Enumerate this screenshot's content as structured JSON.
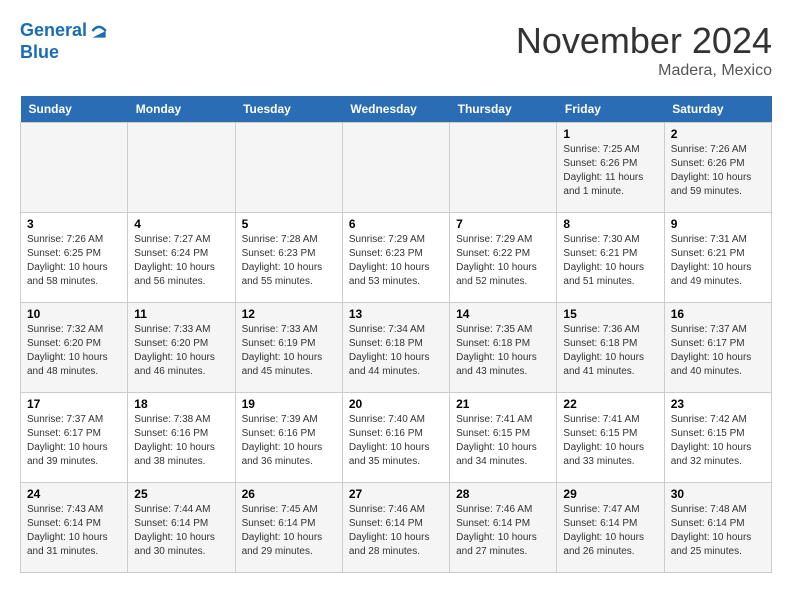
{
  "logo": {
    "line1": "General",
    "line2": "Blue"
  },
  "title": "November 2024",
  "location": "Madera, Mexico",
  "days_of_week": [
    "Sunday",
    "Monday",
    "Tuesday",
    "Wednesday",
    "Thursday",
    "Friday",
    "Saturday"
  ],
  "weeks": [
    [
      {
        "num": "",
        "info": ""
      },
      {
        "num": "",
        "info": ""
      },
      {
        "num": "",
        "info": ""
      },
      {
        "num": "",
        "info": ""
      },
      {
        "num": "",
        "info": ""
      },
      {
        "num": "1",
        "info": "Sunrise: 7:25 AM\nSunset: 6:26 PM\nDaylight: 11 hours and 1 minute."
      },
      {
        "num": "2",
        "info": "Sunrise: 7:26 AM\nSunset: 6:26 PM\nDaylight: 10 hours and 59 minutes."
      }
    ],
    [
      {
        "num": "3",
        "info": "Sunrise: 7:26 AM\nSunset: 6:25 PM\nDaylight: 10 hours and 58 minutes."
      },
      {
        "num": "4",
        "info": "Sunrise: 7:27 AM\nSunset: 6:24 PM\nDaylight: 10 hours and 56 minutes."
      },
      {
        "num": "5",
        "info": "Sunrise: 7:28 AM\nSunset: 6:23 PM\nDaylight: 10 hours and 55 minutes."
      },
      {
        "num": "6",
        "info": "Sunrise: 7:29 AM\nSunset: 6:23 PM\nDaylight: 10 hours and 53 minutes."
      },
      {
        "num": "7",
        "info": "Sunrise: 7:29 AM\nSunset: 6:22 PM\nDaylight: 10 hours and 52 minutes."
      },
      {
        "num": "8",
        "info": "Sunrise: 7:30 AM\nSunset: 6:21 PM\nDaylight: 10 hours and 51 minutes."
      },
      {
        "num": "9",
        "info": "Sunrise: 7:31 AM\nSunset: 6:21 PM\nDaylight: 10 hours and 49 minutes."
      }
    ],
    [
      {
        "num": "10",
        "info": "Sunrise: 7:32 AM\nSunset: 6:20 PM\nDaylight: 10 hours and 48 minutes."
      },
      {
        "num": "11",
        "info": "Sunrise: 7:33 AM\nSunset: 6:20 PM\nDaylight: 10 hours and 46 minutes."
      },
      {
        "num": "12",
        "info": "Sunrise: 7:33 AM\nSunset: 6:19 PM\nDaylight: 10 hours and 45 minutes."
      },
      {
        "num": "13",
        "info": "Sunrise: 7:34 AM\nSunset: 6:18 PM\nDaylight: 10 hours and 44 minutes."
      },
      {
        "num": "14",
        "info": "Sunrise: 7:35 AM\nSunset: 6:18 PM\nDaylight: 10 hours and 43 minutes."
      },
      {
        "num": "15",
        "info": "Sunrise: 7:36 AM\nSunset: 6:18 PM\nDaylight: 10 hours and 41 minutes."
      },
      {
        "num": "16",
        "info": "Sunrise: 7:37 AM\nSunset: 6:17 PM\nDaylight: 10 hours and 40 minutes."
      }
    ],
    [
      {
        "num": "17",
        "info": "Sunrise: 7:37 AM\nSunset: 6:17 PM\nDaylight: 10 hours and 39 minutes."
      },
      {
        "num": "18",
        "info": "Sunrise: 7:38 AM\nSunset: 6:16 PM\nDaylight: 10 hours and 38 minutes."
      },
      {
        "num": "19",
        "info": "Sunrise: 7:39 AM\nSunset: 6:16 PM\nDaylight: 10 hours and 36 minutes."
      },
      {
        "num": "20",
        "info": "Sunrise: 7:40 AM\nSunset: 6:16 PM\nDaylight: 10 hours and 35 minutes."
      },
      {
        "num": "21",
        "info": "Sunrise: 7:41 AM\nSunset: 6:15 PM\nDaylight: 10 hours and 34 minutes."
      },
      {
        "num": "22",
        "info": "Sunrise: 7:41 AM\nSunset: 6:15 PM\nDaylight: 10 hours and 33 minutes."
      },
      {
        "num": "23",
        "info": "Sunrise: 7:42 AM\nSunset: 6:15 PM\nDaylight: 10 hours and 32 minutes."
      }
    ],
    [
      {
        "num": "24",
        "info": "Sunrise: 7:43 AM\nSunset: 6:14 PM\nDaylight: 10 hours and 31 minutes."
      },
      {
        "num": "25",
        "info": "Sunrise: 7:44 AM\nSunset: 6:14 PM\nDaylight: 10 hours and 30 minutes."
      },
      {
        "num": "26",
        "info": "Sunrise: 7:45 AM\nSunset: 6:14 PM\nDaylight: 10 hours and 29 minutes."
      },
      {
        "num": "27",
        "info": "Sunrise: 7:46 AM\nSunset: 6:14 PM\nDaylight: 10 hours and 28 minutes."
      },
      {
        "num": "28",
        "info": "Sunrise: 7:46 AM\nSunset: 6:14 PM\nDaylight: 10 hours and 27 minutes."
      },
      {
        "num": "29",
        "info": "Sunrise: 7:47 AM\nSunset: 6:14 PM\nDaylight: 10 hours and 26 minutes."
      },
      {
        "num": "30",
        "info": "Sunrise: 7:48 AM\nSunset: 6:14 PM\nDaylight: 10 hours and 25 minutes."
      }
    ]
  ]
}
